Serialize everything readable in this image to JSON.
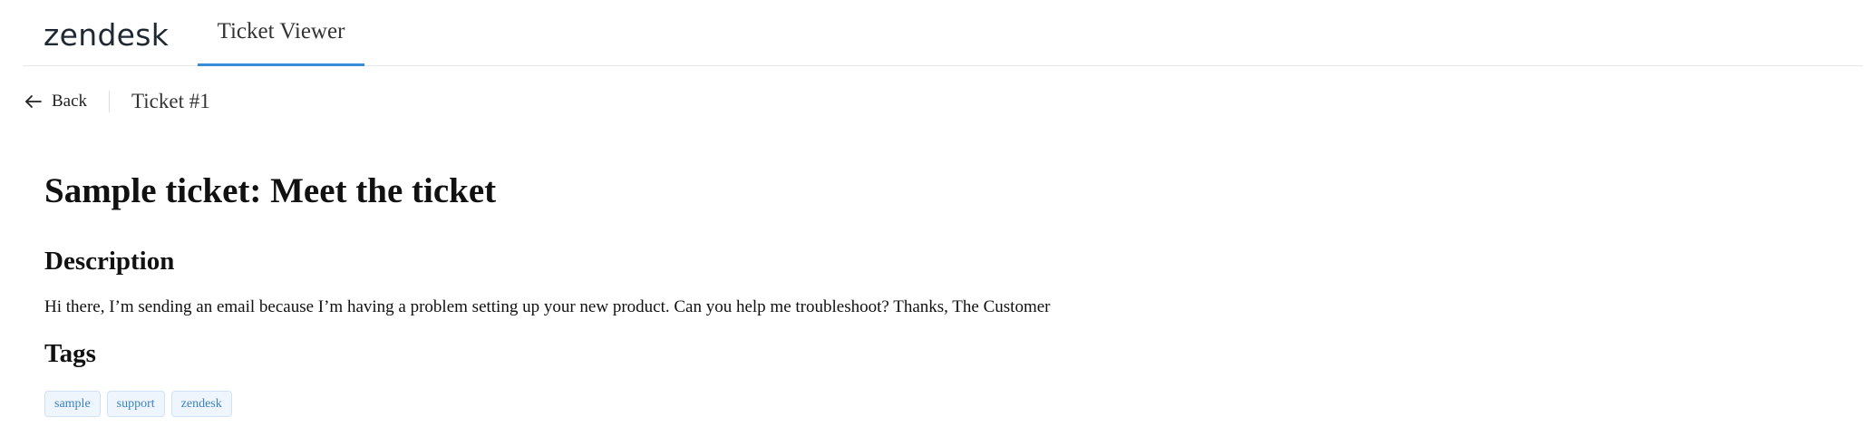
{
  "header": {
    "logo_text": "zendesk",
    "nav_tab_label": "Ticket Viewer"
  },
  "breadcrumb": {
    "back_label": "Back",
    "back_icon": "arrow-left-icon",
    "current": "Ticket #1"
  },
  "ticket": {
    "title": "Sample ticket: Meet the ticket",
    "description_heading": "Description",
    "description": "Hi there, I’m sending an email because I’m having a problem setting up your new product. Can you help me troubleshoot? Thanks, The Customer",
    "tags_heading": "Tags",
    "tags": [
      "sample",
      "support",
      "zendesk"
    ]
  },
  "colors": {
    "accent": "#3b8cd6",
    "tag_text": "#3b82c4",
    "tag_background": "#eef5fd"
  }
}
